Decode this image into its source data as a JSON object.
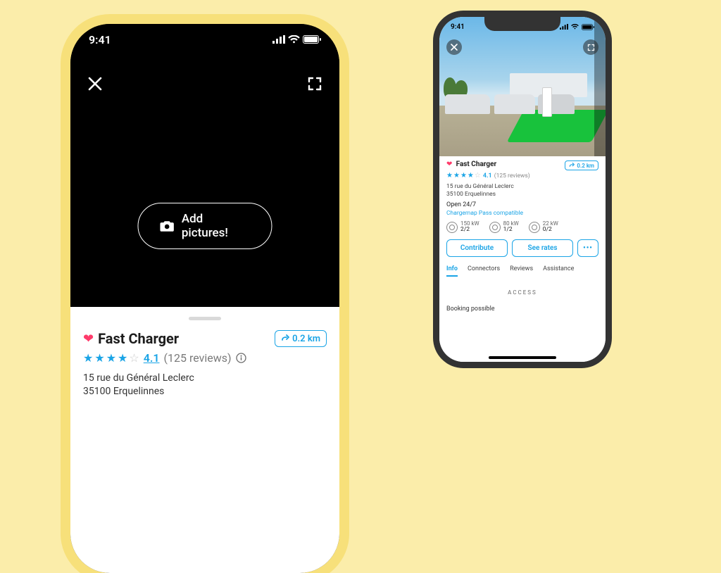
{
  "status": {
    "time": "9:41"
  },
  "left": {
    "add_pictures": "Add pictures!",
    "title": "Fast Charger",
    "distance": "0.2 km",
    "rating": "4.1",
    "reviews": "(125 reviews)",
    "addr1": "15 rue du Général Leclerc",
    "addr2": "35100 Erquelinnes"
  },
  "right": {
    "title": "Fast Charger",
    "distance": "0.2 km",
    "rating": "4.1",
    "reviews": "(125 reviews)",
    "addr1": "15 rue du Général Leclerc",
    "addr2": "35100 Erquelinnes",
    "open": "Open 24/7",
    "pass": "Chargemap Pass compatible",
    "connectors": [
      {
        "kw": "150 kW",
        "avail": "2/2"
      },
      {
        "kw": "80 kW",
        "avail": "1/2"
      },
      {
        "kw": "22 kW",
        "avail": "0/2"
      }
    ],
    "buttons": {
      "contribute": "Contribute",
      "rates": "See rates"
    },
    "tabs": {
      "info": "Info",
      "connectors": "Connectors",
      "reviews": "Reviews",
      "assistance": "Assistance"
    },
    "access_heading": "ACCESS",
    "booking": "Booking possible"
  }
}
